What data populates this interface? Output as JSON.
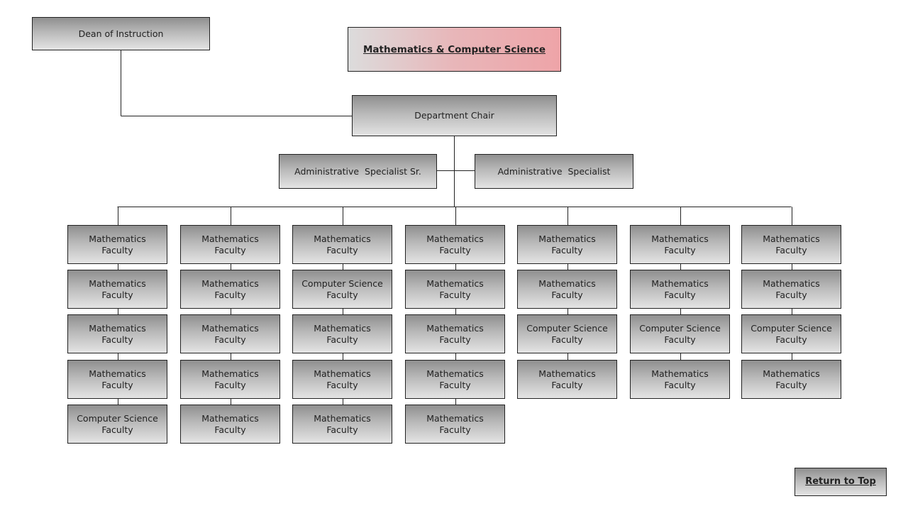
{
  "title": "Mathematics & Computer Science",
  "dean": "Dean of Instruction",
  "chair": "Department Chair",
  "admin": [
    "Administrative  Specialist Sr.",
    "Administrative  Specialist"
  ],
  "columns": [
    [
      "Mathematics Faculty",
      "Mathematics Faculty",
      "Mathematics Faculty",
      "Mathematics Faculty",
      "Computer Science Faculty"
    ],
    [
      "Mathematics Faculty",
      "Mathematics Faculty",
      "Mathematics Faculty",
      "Mathematics Faculty",
      "Mathematics Faculty"
    ],
    [
      "Mathematics Faculty",
      "Computer Science Faculty",
      "Mathematics Faculty",
      "Mathematics Faculty",
      "Mathematics Faculty"
    ],
    [
      "Mathematics Faculty",
      "Mathematics Faculty",
      "Mathematics Faculty",
      "Mathematics Faculty",
      "Mathematics Faculty"
    ],
    [
      "Mathematics Faculty",
      "Mathematics Faculty",
      "Computer Science Faculty",
      "Mathematics Faculty"
    ],
    [
      "Mathematics Faculty",
      "Mathematics Faculty",
      "Computer Science Faculty",
      "Mathematics Faculty"
    ],
    [
      "Mathematics Faculty",
      "Mathematics Faculty",
      "Computer Science Faculty",
      "Mathematics Faculty"
    ]
  ],
  "return_to_top": "Return to Top"
}
